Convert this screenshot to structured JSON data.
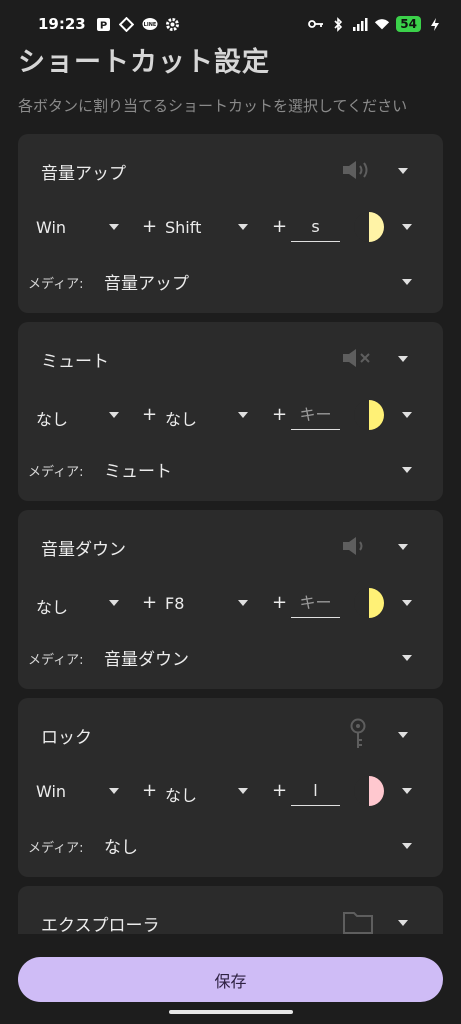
{
  "status": {
    "time": "19:23",
    "battery": "54",
    "icons": [
      "p-box-icon",
      "diamond-icon",
      "line-icon",
      "gear-icon",
      "key-icon",
      "bluetooth-icon",
      "signal-icon",
      "wifi-icon",
      "charging-icon"
    ]
  },
  "page": {
    "title": "ショートカット設定",
    "subtitle": "各ボタンに割り当てるショートカットを選択してください"
  },
  "media_label": "メディア:",
  "plus": "+",
  "cards": [
    {
      "name": "音量アップ",
      "icon": "volume-up-icon",
      "mod1": "Win",
      "mod2": "Shift",
      "key": "s",
      "key_is_placeholder": false,
      "color": "#fff3a6",
      "media": "音量アップ"
    },
    {
      "name": "ミュート",
      "icon": "mute-icon",
      "mod1": "なし",
      "mod2": "なし",
      "key": "キー",
      "key_is_placeholder": true,
      "color": "#fff176",
      "media": "ミュート"
    },
    {
      "name": "音量ダウン",
      "icon": "volume-down-icon",
      "mod1": "なし",
      "mod2": "F8",
      "key": "キー",
      "key_is_placeholder": true,
      "color": "#fff176",
      "media": "音量ダウン"
    },
    {
      "name": "ロック",
      "icon": "lock-key-icon",
      "mod1": "Win",
      "mod2": "なし",
      "key": "l",
      "key_is_placeholder": false,
      "color": "#ffc8cf",
      "media": "なし"
    },
    {
      "name": "エクスプローラ",
      "icon": "folder-icon"
    }
  ],
  "save_label": "保存"
}
